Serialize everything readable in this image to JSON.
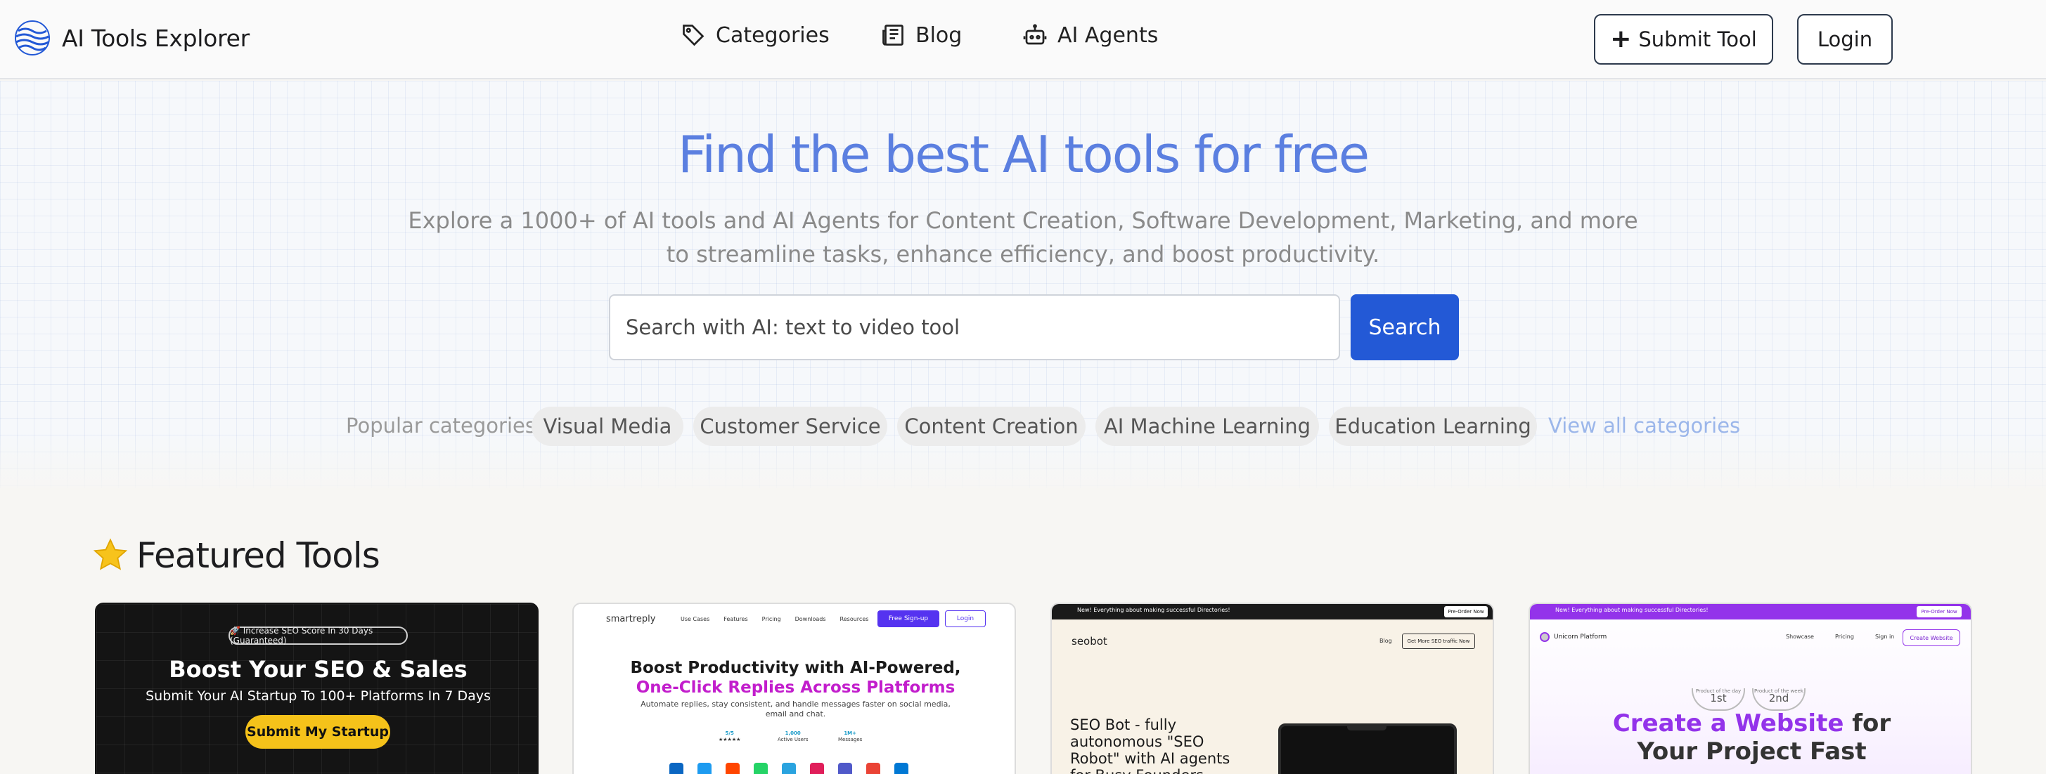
{
  "header": {
    "app_title": "AI Tools Explorer",
    "nav": [
      {
        "label": "Categories",
        "icon": "tag-icon"
      },
      {
        "label": "Blog",
        "icon": "newspaper-icon"
      },
      {
        "label": "AI Agents",
        "icon": "robot-icon"
      }
    ],
    "submit_label": "Submit Tool",
    "login_label": "Login"
  },
  "hero": {
    "title": "Find the best AI tools for free",
    "subtitle_line1": "Explore a 1000+ of AI tools and AI Agents for Content Creation, Software Development, Marketing, and more",
    "subtitle_line2": "to streamline tasks, enhance efficiency, and boost productivity.",
    "search_placeholder": "Search with AI: text to video tool",
    "search_button": "Search",
    "popular_label": "Popular categories:",
    "categories": [
      "Visual Media",
      "Customer Service",
      "Content Creation",
      "AI Machine Learning",
      "Education Learning"
    ],
    "view_all": "View all categories"
  },
  "featured": {
    "title": "Featured Tools",
    "cards": [
      {
        "pill": "🚀 Increase SEO Score In 30 Days (Guaranteed)",
        "title": "Boost Your SEO & Sales",
        "subtitle": "Submit Your AI Startup To 100+ Platforms In 7 Days",
        "button": "Submit My Startup"
      },
      {
        "logo": "smartreply",
        "links": [
          "Use Cases",
          "Features",
          "Pricing",
          "Downloads",
          "Resources"
        ],
        "free_signup": "Free Sign-up",
        "login": "Login",
        "headline1": "Boost Productivity with AI-Powered,",
        "headline2": "One-Click Replies Across Platforms",
        "desc": "Automate replies, stay consistent, and handle messages faster on social media, email and chat.",
        "stats": [
          {
            "value": "5/5",
            "label": "★★★★★"
          },
          {
            "value": "1,000",
            "label": "Active Users"
          },
          {
            "value": "1M+",
            "label": "Messages"
          }
        ]
      },
      {
        "banner": "New! Everything about making successful Directories!",
        "banner_button": "Pre-Order Now",
        "logo": "seobot",
        "blog": "Blog",
        "cta": "Get More SEO traffic Now",
        "text": "SEO Bot - fully autonomous \"SEO Robot\" with AI agents for Busy Founders"
      },
      {
        "banner": "New! Everything about making successful Directories!",
        "banner_button": "Pre-Order Now",
        "logo": "Unicorn Platform",
        "links": [
          "Showcase",
          "Pricing",
          "Sign in"
        ],
        "cta": "Create Website",
        "badge1_top": "Product of the day",
        "badge1": "1st",
        "badge2_top": "Product of the week",
        "badge2": "2nd",
        "headline_grad": "Create a Website",
        "headline_rest": " for",
        "headline2": "Your Project Fast"
      }
    ]
  },
  "colors": {
    "accent": "#2359d6",
    "hero_title": "#5b7fe0",
    "view_all": "#9bb6ea"
  }
}
